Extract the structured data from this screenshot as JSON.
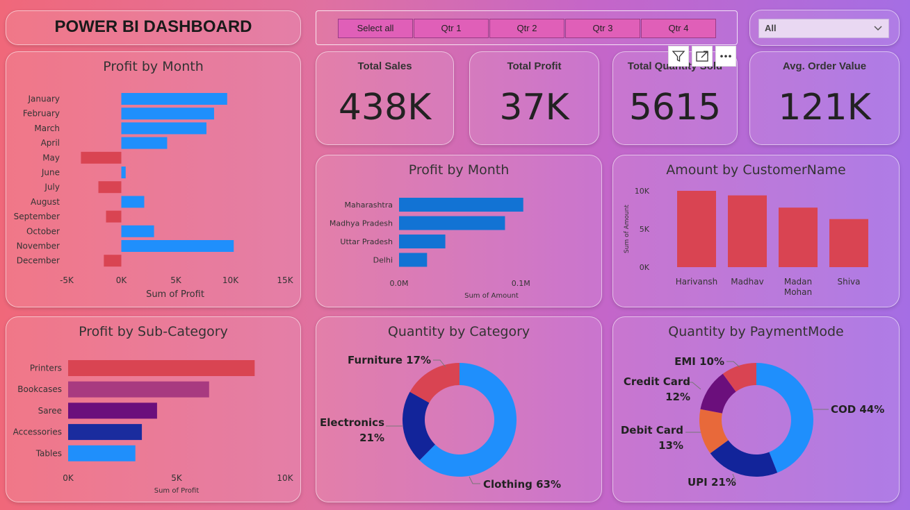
{
  "header": {
    "title": "POWER BI DASHBOARD"
  },
  "slicer": {
    "options": [
      "Select all",
      "Qtr 1",
      "Qtr 2",
      "Qtr 3",
      "Qtr 4"
    ]
  },
  "dropdown": {
    "value": "All",
    "icon": "chevron-down-icon"
  },
  "visual_header": {
    "icons": [
      "filter-icon",
      "focus-mode-icon",
      "more-options-icon"
    ]
  },
  "kpis": [
    {
      "label": "Total Sales",
      "value": "438K"
    },
    {
      "label": "Total Profit",
      "value": "37K"
    },
    {
      "label": "Total Quantity Sold",
      "value": "5615"
    },
    {
      "label": "Avg. Order Value",
      "value": "121K"
    }
  ],
  "colors": {
    "positive": "#1f8ffc",
    "negative": "#d94452",
    "state_bar": "#1273d4",
    "customer_bar": "#d94452"
  },
  "charts": {
    "profit_by_month": {
      "title": "Profit by Month",
      "chart_data": {
        "type": "bar",
        "orientation": "horizontal",
        "categories": [
          "January",
          "February",
          "March",
          "April",
          "May",
          "June",
          "July",
          "August",
          "September",
          "October",
          "November",
          "December"
        ],
        "values": [
          9700,
          8500,
          7800,
          4200,
          -3700,
          400,
          -2100,
          2100,
          -1400,
          3000,
          10300,
          -1600
        ],
        "xlabel": "Sum of Profit",
        "xlim": [
          -5000,
          15000
        ],
        "xticks": [
          "-5K",
          "0K",
          "5K",
          "10K",
          "15K"
        ]
      }
    },
    "profit_by_state": {
      "title": "Profit by Month",
      "chart_data": {
        "type": "bar",
        "orientation": "horizontal",
        "categories": [
          "Maharashtra",
          "Madhya Pradesh",
          "Uttar Pradesh",
          "Delhi"
        ],
        "values": [
          102000,
          87000,
          38000,
          23000
        ],
        "xlabel": "Sum of Amount",
        "xlim": [
          0,
          125000
        ],
        "xticks": [
          "0.0M",
          "0.1M"
        ]
      }
    },
    "amount_by_customer": {
      "title": "Amount by CustomerName",
      "chart_data": {
        "type": "bar",
        "orientation": "vertical",
        "categories": [
          "Harivansh",
          "Madhav",
          "Madan Mohan",
          "Shiva"
        ],
        "values": [
          10000,
          9400,
          7800,
          6300
        ],
        "ylabel": "Sum of Amount",
        "ylim": [
          0,
          10000
        ],
        "yticks": [
          "10K",
          "5K",
          "0K"
        ]
      }
    },
    "profit_by_subcategory": {
      "title": "Profit by Sub-Category",
      "chart_data": {
        "type": "bar",
        "orientation": "horizontal",
        "categories": [
          "Printers",
          "Bookcases",
          "Saree",
          "Accessories",
          "Tables"
        ],
        "values": [
          8600,
          6500,
          4100,
          3400,
          3100
        ],
        "colors": [
          "#d94452",
          "#a83a80",
          "#6b0f7c",
          "#1a2c9e",
          "#1f8ffc"
        ],
        "xlabel": "Sum of Profit",
        "xlim": [
          0,
          10000
        ],
        "xticks": [
          "0K",
          "5K",
          "10K"
        ]
      }
    },
    "quantity_by_category": {
      "title": "Quantity by Category",
      "chart_data": {
        "type": "pie",
        "donut": true,
        "labels": [
          "Clothing",
          "Electronics",
          "Furniture"
        ],
        "values": [
          63,
          21,
          17
        ],
        "colors": [
          "#1f8ffc",
          "#12249a",
          "#d94452"
        ],
        "label_text": [
          "Clothing 63%",
          "Electronics",
          "21%",
          "Furniture 17%"
        ]
      }
    },
    "quantity_by_paymentmode": {
      "title": "Quantity by PaymentMode",
      "chart_data": {
        "type": "pie",
        "donut": true,
        "labels": [
          "COD",
          "UPI",
          "Debit Card",
          "Credit Card",
          "EMI"
        ],
        "values": [
          44,
          21,
          13,
          12,
          10
        ],
        "colors": [
          "#1f8ffc",
          "#12249a",
          "#e8693a",
          "#6b0f7c",
          "#d94452"
        ],
        "label_text": [
          "COD 44%",
          "UPI 21%",
          "Debit Card",
          "13%",
          "Credit Card",
          "12%",
          "EMI 10%"
        ]
      }
    }
  }
}
